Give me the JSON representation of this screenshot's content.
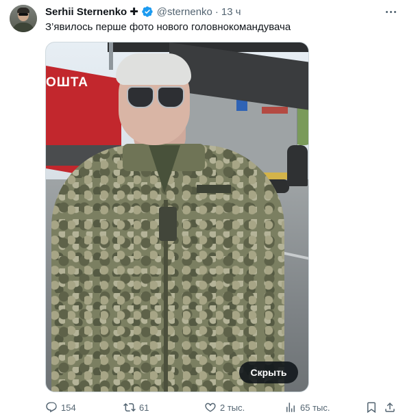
{
  "author": {
    "name": "Serhii Sternenko",
    "badge_glyph": "✚",
    "handle": "@sternenko",
    "separator": "·",
    "time": "13 ч"
  },
  "tweet": {
    "text": "З’явилось перше фото нового головнокомандувача"
  },
  "media": {
    "truck_label": "ОШТА",
    "hide_button": "Скрыть"
  },
  "actions": {
    "replies": "154",
    "retweets": "61",
    "likes": "2 тыс.",
    "views": "65 тыс."
  },
  "icons": {
    "verified": "verified-badge-icon",
    "more": "more-icon",
    "reply": "reply-icon",
    "retweet": "retweet-icon",
    "like": "heart-icon",
    "views": "analytics-icon",
    "bookmark": "bookmark-icon",
    "share": "share-icon"
  },
  "colors": {
    "verified": "#1d9bf0",
    "secondary_text": "#536471",
    "primary_text": "#0f1419"
  }
}
